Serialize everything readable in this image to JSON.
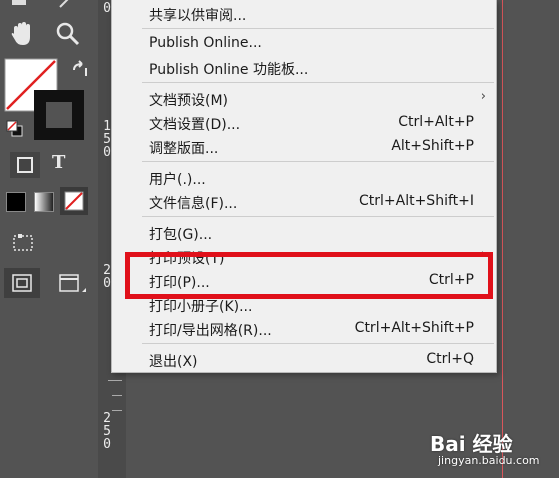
{
  "menu": {
    "items": [
      {
        "label": "共享以供审阅...",
        "shortcut": ""
      },
      {
        "label": "Publish Online...",
        "shortcut": ""
      },
      {
        "label": "Publish Online 功能板...",
        "shortcut": ""
      },
      {
        "label": "文档预设(M)",
        "shortcut": "",
        "submenu": true
      },
      {
        "label": "文档设置(D)...",
        "shortcut": "Ctrl+Alt+P"
      },
      {
        "label": "调整版面...",
        "shortcut": "Alt+Shift+P"
      },
      {
        "label": "用户(.)...",
        "shortcut": ""
      },
      {
        "label": "文件信息(F)...",
        "shortcut": "Ctrl+Alt+Shift+I"
      },
      {
        "label": "打包(G)...",
        "shortcut": ""
      },
      {
        "label": "打印预设(T)",
        "shortcut": "",
        "submenu": true
      },
      {
        "label": "打印(P)...",
        "shortcut": "Ctrl+P"
      },
      {
        "label": "打印小册子(K)...",
        "shortcut": ""
      },
      {
        "label": "打印/导出网格(R)...",
        "shortcut": "Ctrl+Alt+Shift+P"
      },
      {
        "label": "退出(X)",
        "shortcut": "Ctrl+Q"
      }
    ]
  },
  "ruler": {
    "labels": [
      "0",
      "1 5 0",
      "2 0",
      "2 5 0"
    ]
  },
  "tools": {
    "type_tool_glyph": "T"
  },
  "watermark": {
    "brand": "Bai 经验",
    "url": "jingyan.baidu.com"
  },
  "colors": {
    "highlight": "#e0101a",
    "menu_bg": "#f0f0f0",
    "ui_bg": "#535353"
  }
}
